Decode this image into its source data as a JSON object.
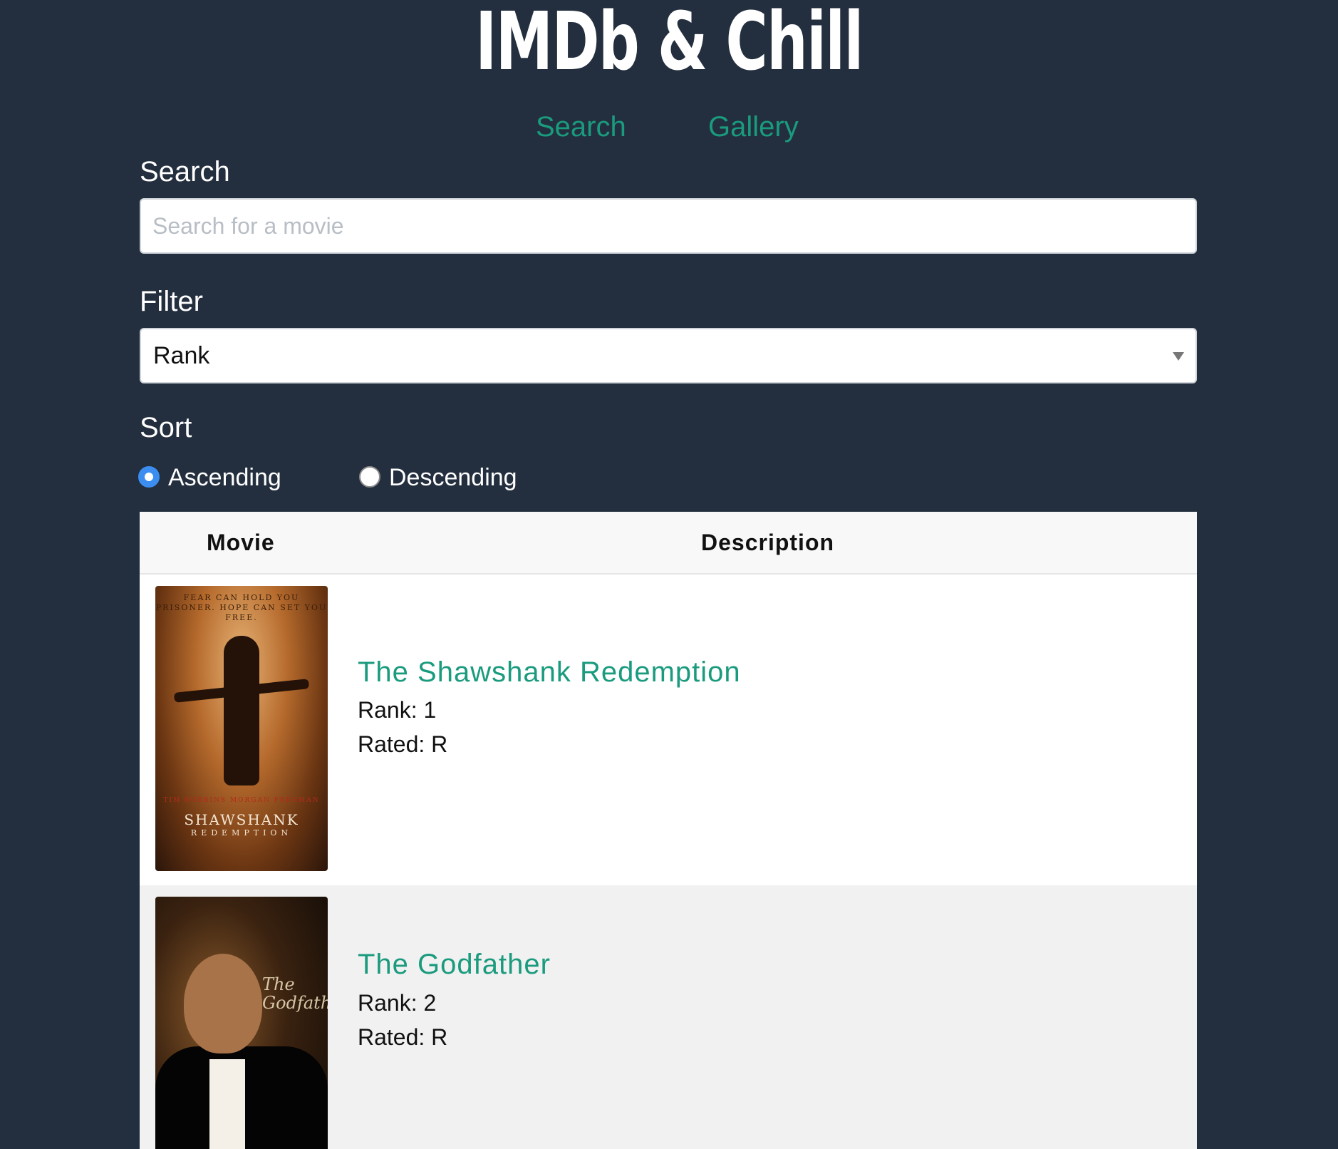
{
  "app": {
    "title": "IMDb & Chill"
  },
  "nav": {
    "search_label": "Search",
    "gallery_label": "Gallery"
  },
  "search": {
    "label": "Search",
    "placeholder": "Search for a movie",
    "value": ""
  },
  "filter": {
    "label": "Filter",
    "selected": "Rank"
  },
  "sort": {
    "label": "Sort",
    "options": [
      {
        "label": "Ascending",
        "checked": true
      },
      {
        "label": "Descending",
        "checked": false
      }
    ]
  },
  "table": {
    "headers": {
      "movie": "Movie",
      "description": "Description"
    },
    "rows": [
      {
        "title": "The Shawshank Redemption",
        "rank": "Rank: 1",
        "rated": "Rated: R",
        "poster": {
          "tagline": "FEAR CAN HOLD YOU PRISONER. HOPE CAN SET YOU FREE.",
          "names": "TIM ROBBINS   MORGAN FREEMAN",
          "title": "SHAWSHANK",
          "subtitle": "REDEMPTION"
        }
      },
      {
        "title": "The Godfather",
        "rank": "Rank: 2",
        "rated": "Rated: R",
        "poster": {
          "logo": "The Godfather"
        }
      }
    ]
  },
  "colors": {
    "background": "#232f3e",
    "accent": "#1a9b7e",
    "radio_checked": "#3b8ef0"
  }
}
